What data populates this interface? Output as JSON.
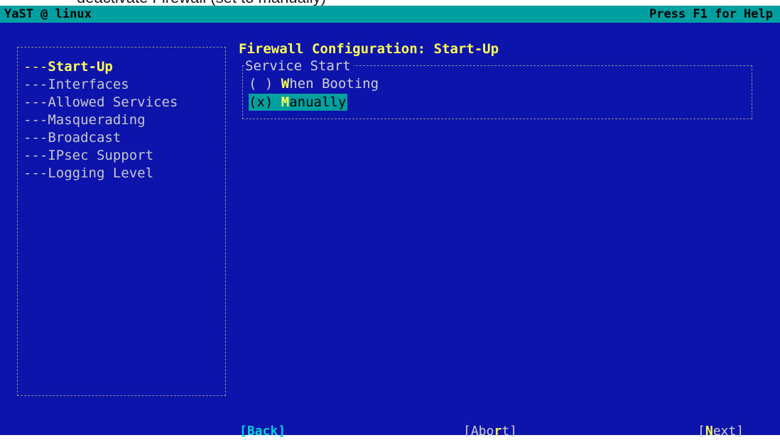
{
  "caption": "deactivate Firewall (set to manually)",
  "titlebar": {
    "left": "YaST @ linux",
    "right": "Press F1 for Help"
  },
  "tree": {
    "prefix": "---",
    "items": [
      {
        "label": "Start-Up",
        "selected": true
      },
      {
        "label": "Interfaces",
        "selected": false
      },
      {
        "label": "Allowed Services",
        "selected": false
      },
      {
        "label": "Masquerading",
        "selected": false
      },
      {
        "label": "Broadcast",
        "selected": false
      },
      {
        "label": "IPsec Support",
        "selected": false
      },
      {
        "label": "Logging Level",
        "selected": false
      }
    ]
  },
  "main": {
    "heading": "Firewall Configuration: Start-Up",
    "frame_label": "Service Start",
    "options": [
      {
        "mark": "( )",
        "hotkey": "W",
        "rest": "hen Booting",
        "selected": false
      },
      {
        "mark": "(x)",
        "hotkey": "M",
        "rest": "anually",
        "selected": true
      }
    ]
  },
  "buttons": {
    "back": {
      "open": "[",
      "hot": "",
      "label": "Back",
      "close": "]"
    },
    "abort": {
      "open": "[",
      "pre": "Abo",
      "hot": "r",
      "post": "t",
      "close": "]"
    },
    "next": {
      "open": "[",
      "hot": "N",
      "post": "ext",
      "close": "]"
    }
  },
  "colors": {
    "background": "#0d14ab",
    "titlebar": "#00a0a0",
    "highlight": "#ffff55",
    "text": "#d0d0d0"
  }
}
